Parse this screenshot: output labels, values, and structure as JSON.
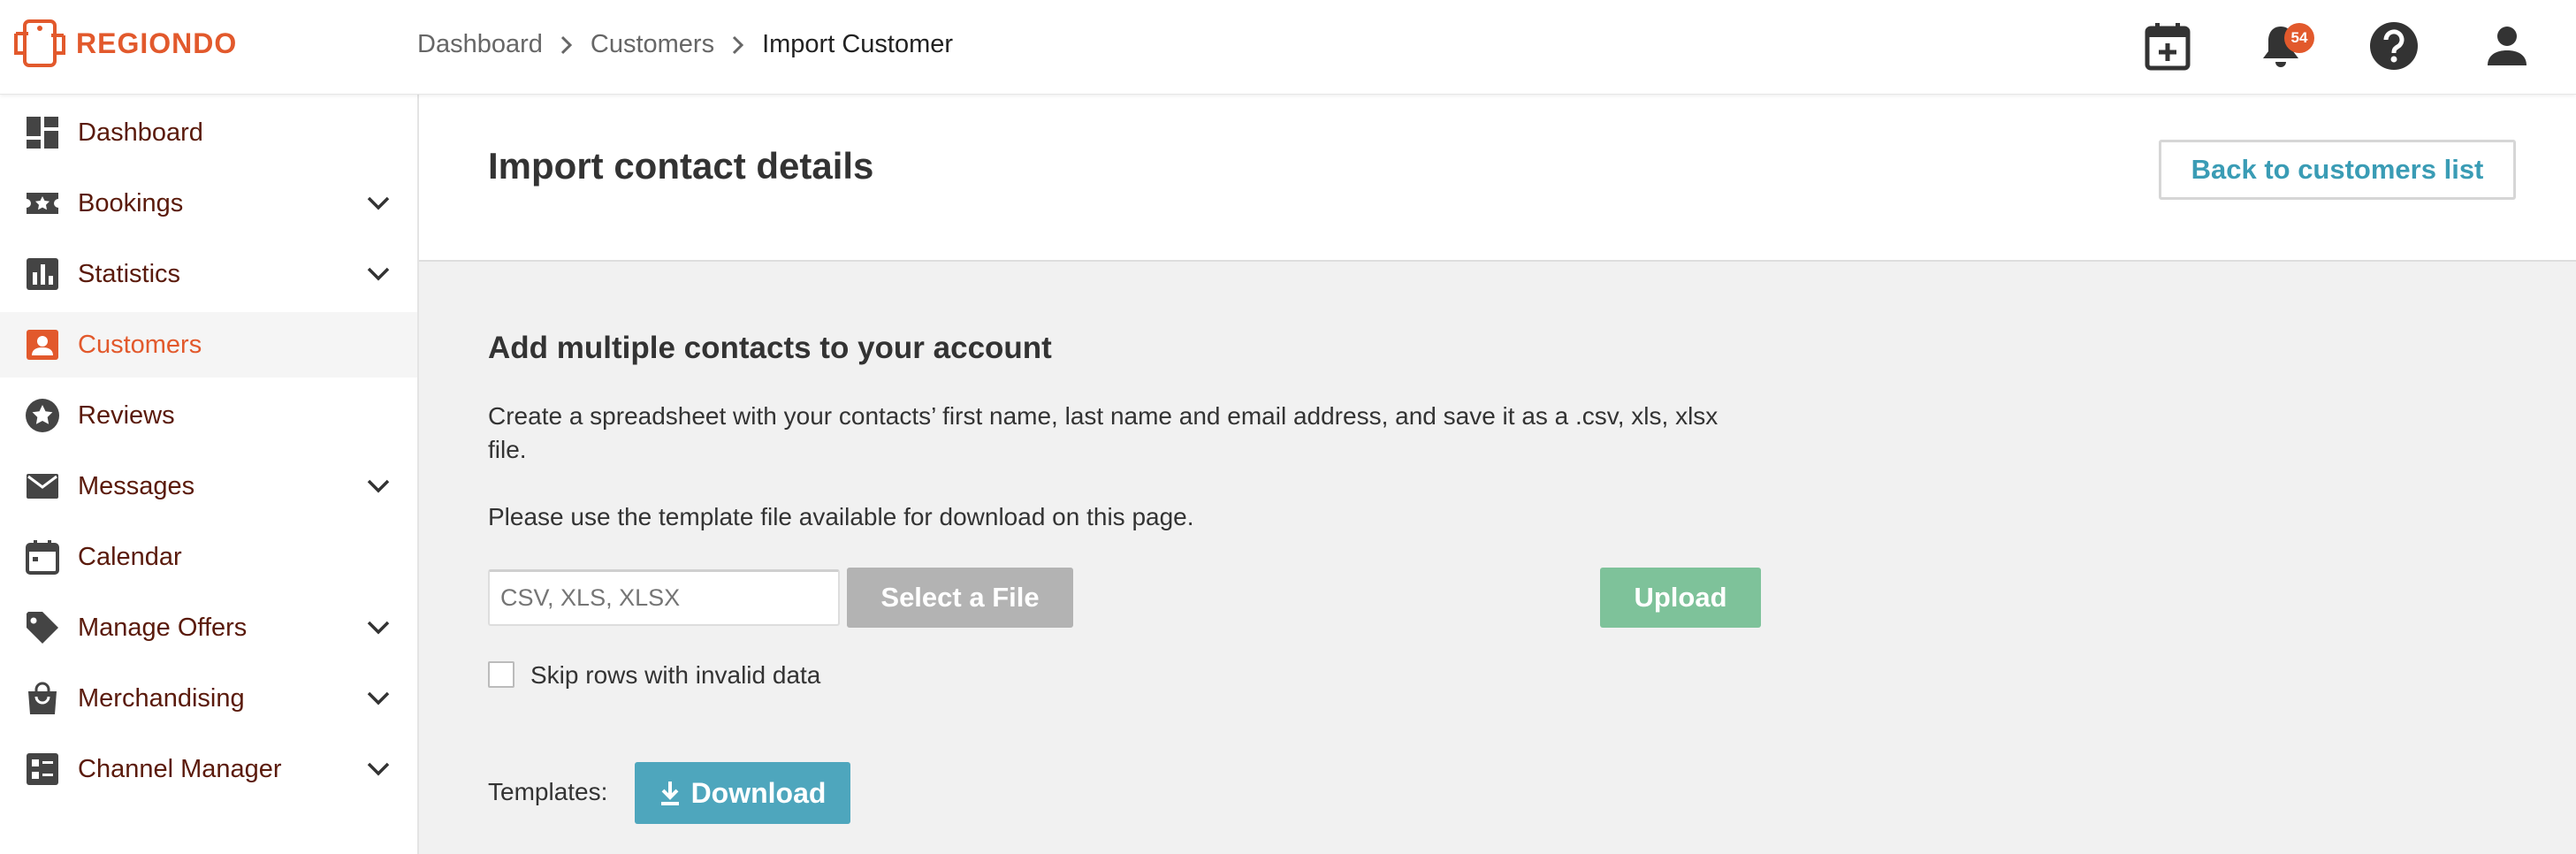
{
  "brand": {
    "name": "REGIONDO",
    "color": "#e2592c"
  },
  "breadcrumb": {
    "items": [
      "Dashboard",
      "Customers"
    ],
    "current": "Import Customer"
  },
  "header": {
    "icons": [
      "calendar-add-icon",
      "bell-icon",
      "help-icon",
      "user-icon"
    ],
    "notifications_count": "54"
  },
  "sidebar": {
    "items": [
      {
        "label": "Dashboard",
        "icon": "dashboard-icon",
        "expandable": false
      },
      {
        "label": "Bookings",
        "icon": "ticket-icon",
        "expandable": true
      },
      {
        "label": "Statistics",
        "icon": "bar-chart-icon",
        "expandable": true
      },
      {
        "label": "Customers",
        "icon": "contact-card-icon",
        "expandable": false,
        "active": true
      },
      {
        "label": "Reviews",
        "icon": "star-icon",
        "expandable": false
      },
      {
        "label": "Messages",
        "icon": "mail-icon",
        "expandable": true
      },
      {
        "label": "Calendar",
        "icon": "calendar-icon",
        "expandable": false
      },
      {
        "label": "Manage Offers",
        "icon": "tag-icon",
        "expandable": true
      },
      {
        "label": "Merchandising",
        "icon": "shopping-bag-icon",
        "expandable": true
      },
      {
        "label": "Channel Manager",
        "icon": "channel-list-icon",
        "expandable": true
      }
    ]
  },
  "main": {
    "title": "Import contact details",
    "back_button": "Back to customers list",
    "section_title": "Add multiple contacts to your account",
    "description": "Create a spreadsheet with your contacts’ first name, last name and email address, and save it as a .csv, xls, xlsx file.",
    "template_note": "Please use the template file available for download on this page.",
    "file_input": {
      "placeholder": "CSV, XLS, XLSX",
      "value": ""
    },
    "select_file_button": "Select a File",
    "upload_button": "Upload",
    "skip_rows_label": "Skip rows with invalid data",
    "skip_rows_checked": false,
    "templates_label": "Templates:",
    "download_button": "Download"
  },
  "colors": {
    "accent": "#e2592c",
    "link": "#3a9cb5",
    "upload": "#7ec29a",
    "download": "#4ea6bd",
    "select": "#b3b3b3"
  }
}
